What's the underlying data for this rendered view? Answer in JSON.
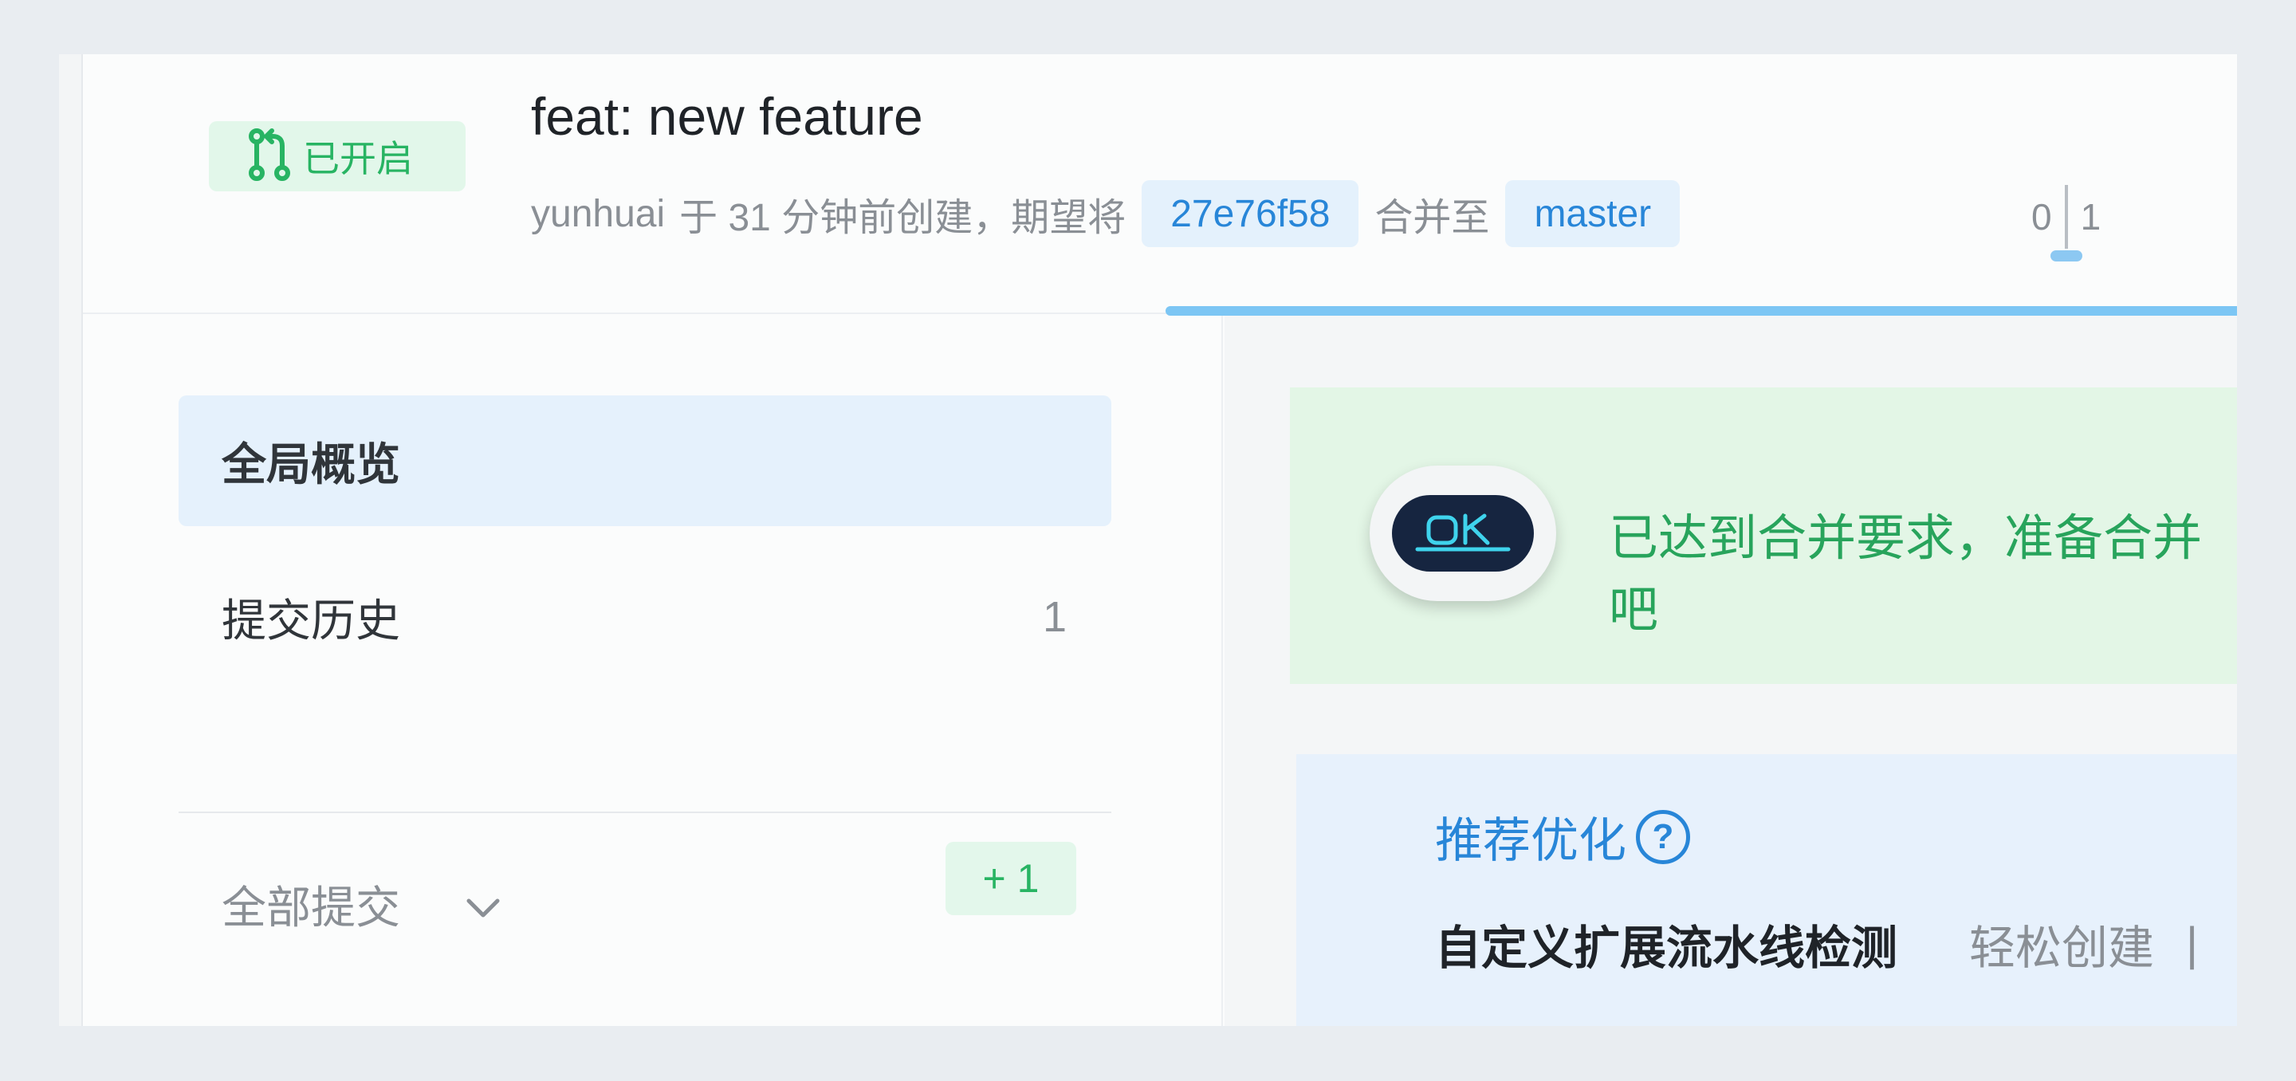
{
  "header": {
    "status": "已开启",
    "title": "feat: new feature",
    "author": "yunhuai",
    "meta_text": "于 31 分钟前创建，期望将",
    "source_branch": "27e76f58",
    "merge_to_text": "合并至",
    "target_branch": "master",
    "counter_left": "0",
    "counter_right": "1"
  },
  "sidebar": {
    "items": [
      {
        "label": "全局概览"
      },
      {
        "label": "提交历史",
        "count": "1"
      }
    ],
    "filter_label": "全部提交",
    "added_badge": "+ 1"
  },
  "main": {
    "ok_message": "已达到合并要求，准备合并吧",
    "ok_badge_text": "OK",
    "recommend": {
      "title": "推荐优化",
      "heading": "自定义扩展流水线检测",
      "subtext": "轻松创建",
      "separator": "|"
    }
  },
  "colors": {
    "accent_green": "#28b463",
    "accent_blue": "#2886d8",
    "progress_blue": "#7cc6f4"
  },
  "icons": [
    "merge-request-icon",
    "chevron-down-icon",
    "help-circle-icon",
    "ok-robot-icon"
  ]
}
